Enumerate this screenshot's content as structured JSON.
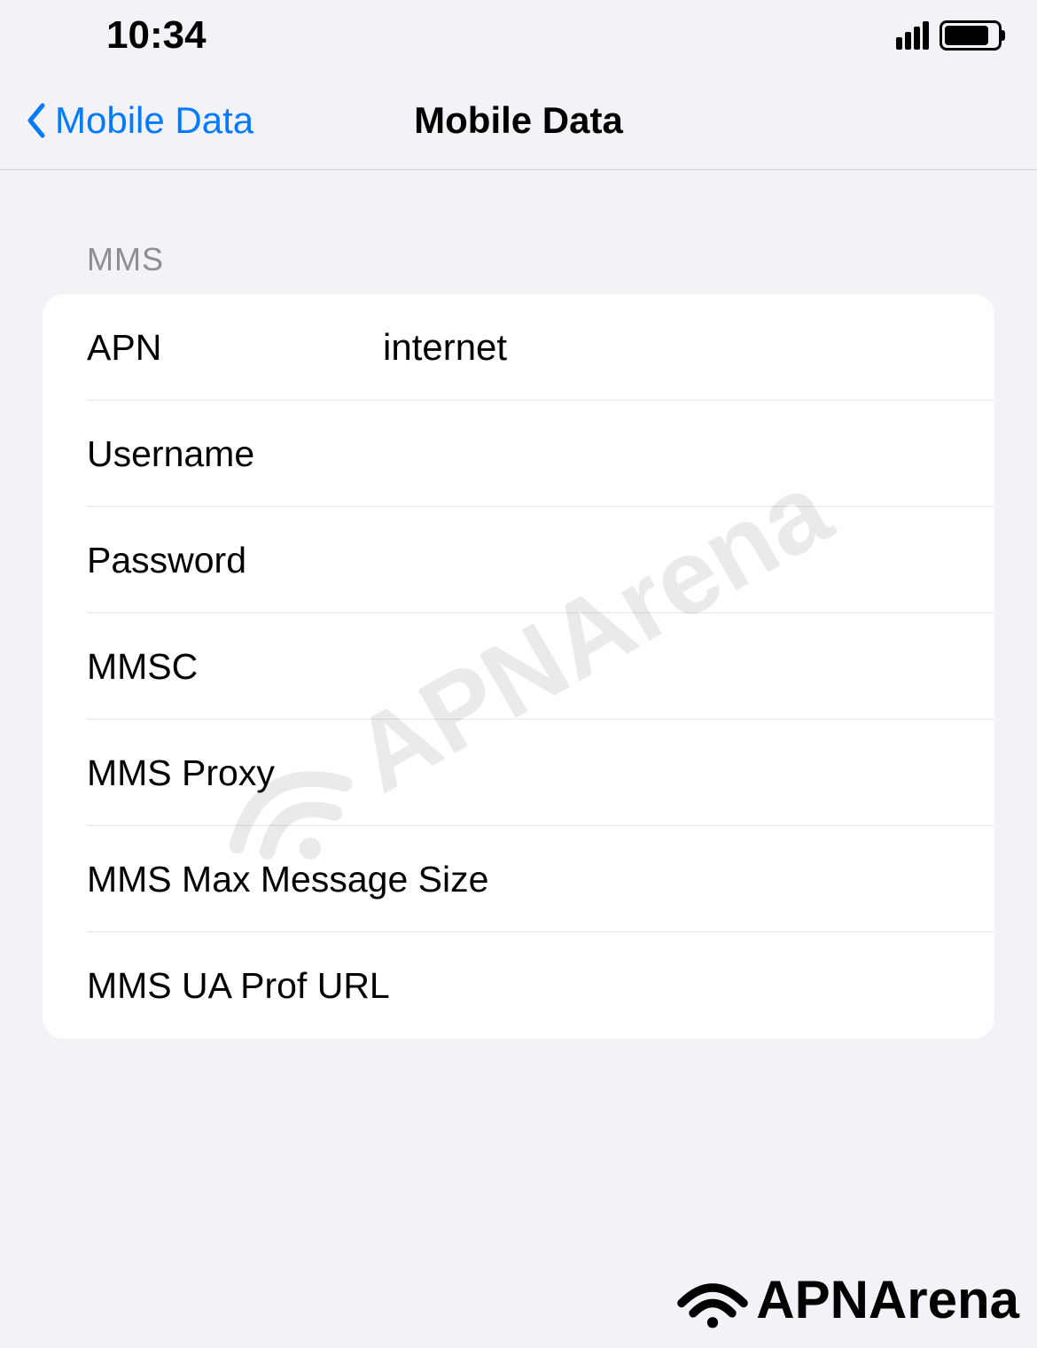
{
  "status": {
    "time": "10:34"
  },
  "nav": {
    "back_label": "Mobile Data",
    "title": "Mobile Data"
  },
  "section": {
    "header": "MMS",
    "rows": [
      {
        "label": "APN",
        "value": "internet"
      },
      {
        "label": "Username",
        "value": ""
      },
      {
        "label": "Password",
        "value": ""
      },
      {
        "label": "MMSC",
        "value": ""
      },
      {
        "label": "MMS Proxy",
        "value": ""
      },
      {
        "label": "MMS Max Message Size",
        "value": ""
      },
      {
        "label": "MMS UA Prof URL",
        "value": ""
      }
    ]
  },
  "watermark": {
    "text": "APNArena"
  },
  "footer": {
    "text": "APNArena"
  }
}
